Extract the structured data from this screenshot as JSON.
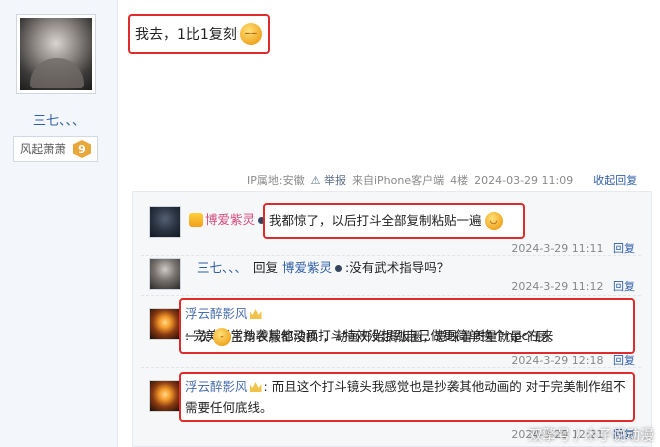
{
  "poster": {
    "name": "三七、、、",
    "title": "风起萧萧",
    "level": "9"
  },
  "post": {
    "content": "我去，1比1复刻",
    "ip_location": "IP属地:安徽",
    "report": "举报",
    "source": "来自iPhone客户端",
    "floor": "4楼",
    "time": "2024-03-29 11:09",
    "collapse_reply": "收起回复"
  },
  "replies": [
    {
      "user": "博爱紫灵",
      "text": "我都惊了，以后打斗全部复制粘贴一遍",
      "time": "2024-3-29 11:11",
      "reply_label": "回复"
    },
    {
      "user": "三七、、、",
      "reply_prefix": "回复",
      "reply_to": "博爱紫灵",
      "text": ":没有武术指导吗？",
      "time": "2024-3-29 11:12",
      "reply_label": "回复"
    },
    {
      "user": "浮云醉影风",
      "text_line1": ": 完美经常抄袭其他动画打斗特效没想到自己做更简单换个npc在来",
      "text_line2_a": "一次",
      "text_line2_b": "主角衣服都没换 ，动画开始搞饭圈，意味着质量就是个屁。",
      "time": "2024-3-29 12:18",
      "reply_label": "回复"
    },
    {
      "user": "浮云醉影风",
      "text_line1": ": 而且这个打斗镜头我感觉也是抄袭其他动画的 对于完美制作组不",
      "text_line2": "需要任何底线。",
      "time": "2024-3-29 12:21",
      "reply_label": "回复"
    }
  ],
  "watermark": "双擎号 / 木子说动漫",
  "colors": {
    "highlight": "#e02b2b",
    "link": "#2f5ea8"
  }
}
